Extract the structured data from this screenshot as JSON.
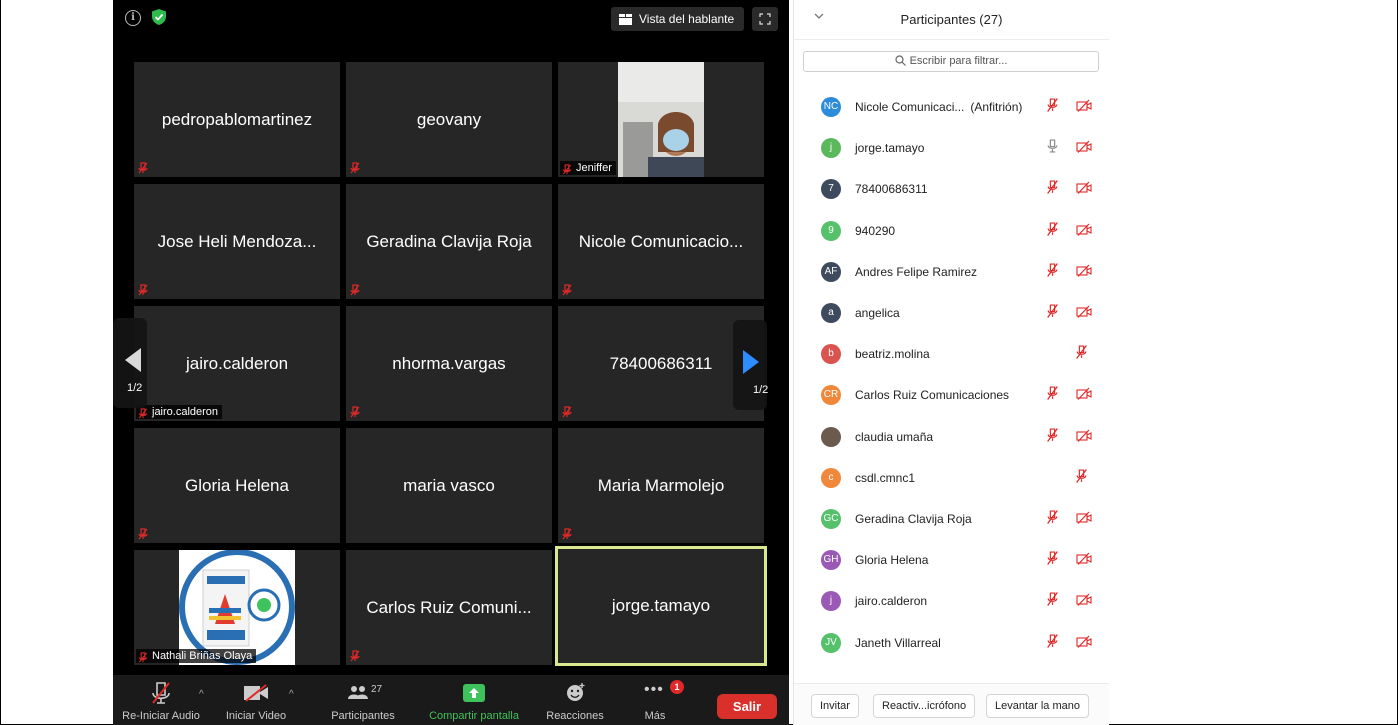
{
  "meeting": {
    "speaker_view_label": "Vista del hablante",
    "tiles": [
      {
        "name": "pedropablomartinez",
        "label": ""
      },
      {
        "name": "geovany",
        "label": ""
      },
      {
        "name": "",
        "label": "Jeniffer",
        "video": true
      },
      {
        "name": "Jose Heli Mendoza...",
        "label": ""
      },
      {
        "name": "Geradina Clavija Roja",
        "label": ""
      },
      {
        "name": "Nicole Comunicacio...",
        "label": ""
      },
      {
        "name": "jairo.calderon",
        "label": "jairo.calderon"
      },
      {
        "name": "nhorma.vargas",
        "label": ""
      },
      {
        "name": "78400686311",
        "label": ""
      },
      {
        "name": "Gloria Helena",
        "label": ""
      },
      {
        "name": "maria vasco",
        "label": ""
      },
      {
        "name": "Maria Marmolejo",
        "label": ""
      },
      {
        "name": "",
        "label": "Nathali Briñas Olaya",
        "logo": true
      },
      {
        "name": "Carlos Ruiz Comuni...",
        "label": ""
      },
      {
        "name": "jorge.tamayo",
        "label": "",
        "active": true
      }
    ],
    "page_left": "1/2",
    "page_right": "1/2"
  },
  "toolbar": {
    "audio_label": "Re-Iniciar Audio",
    "video_label": "Iniciar Video",
    "participants_label": "Participantes",
    "participants_count": "27",
    "share_label": "Compartir pantalla",
    "reactions_label": "Reacciones",
    "more_label": "Más",
    "more_badge": "1",
    "leave_label": "Salir",
    "share_color": "#3ec25b",
    "leave_color": "#d9302b"
  },
  "panel": {
    "title": "Participantes (27)",
    "filter_placeholder": "Escribir para filtrar...",
    "participants": [
      {
        "initials": "NC",
        "color": "#2d8cd9",
        "name": "Nicole Comunicaci...",
        "role": "(Anfitrión)",
        "mic": "muted",
        "cam": "off"
      },
      {
        "initials": "j",
        "color": "#5cb85c",
        "name": "jorge.tamayo",
        "mic": "on",
        "cam": "off"
      },
      {
        "initials": "7",
        "color": "#3e4a5e",
        "name": "78400686311",
        "mic": "muted",
        "cam": "off"
      },
      {
        "initials": "9",
        "color": "#55c16a",
        "name": "940290",
        "mic": "muted",
        "cam": "off"
      },
      {
        "initials": "AF",
        "color": "#3e4a5e",
        "name": "Andres Felipe Ramirez",
        "mic": "muted",
        "cam": "off"
      },
      {
        "initials": "a",
        "color": "#3e4a5e",
        "name": "angelica",
        "mic": "muted",
        "cam": "off"
      },
      {
        "initials": "b",
        "color": "#d9534f",
        "name": "beatriz.molina",
        "mic": "muted",
        "cam": "none"
      },
      {
        "initials": "CR",
        "color": "#f0883c",
        "name": "Carlos Ruiz Comunicaciones",
        "mic": "muted",
        "cam": "off"
      },
      {
        "initials": "",
        "color": "#6b5a4e",
        "name": "claudia umaña",
        "mic": "muted",
        "cam": "off",
        "photo": true
      },
      {
        "initials": "c",
        "color": "#f0883c",
        "name": "csdl.cmnc1",
        "mic": "muted",
        "cam": "none"
      },
      {
        "initials": "GC",
        "color": "#55c16a",
        "name": "Geradina Clavija Roja",
        "mic": "muted",
        "cam": "off"
      },
      {
        "initials": "GH",
        "color": "#9b59b6",
        "name": "Gloria Helena",
        "mic": "muted",
        "cam": "off"
      },
      {
        "initials": "j",
        "color": "#9b59b6",
        "name": "jairo.calderon",
        "mic": "muted",
        "cam": "off"
      },
      {
        "initials": "JV",
        "color": "#55c16a",
        "name": "Janeth Villarreal",
        "mic": "muted",
        "cam": "off"
      }
    ],
    "invite_label": "Invitar",
    "reactivate_label": "Reactiv...icrófono",
    "raise_hand_label": "Levantar la mano"
  },
  "icons": {
    "muted_mic_color": "#e02828",
    "muted_cam_color": "#e02828"
  }
}
